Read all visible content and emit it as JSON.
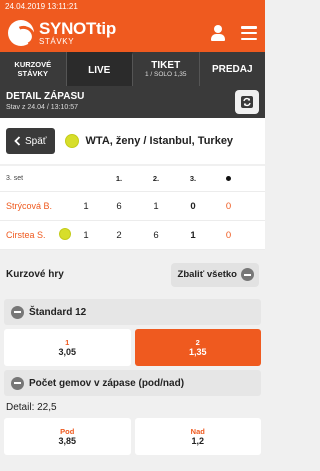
{
  "statusbar": {
    "datetime": "24.04.2019 13:11:21"
  },
  "brand": {
    "name": "SYNOTtip",
    "sub": "STÁVKY"
  },
  "nav": {
    "tabs": [
      {
        "l1": "KURZOVÉ",
        "l2": "STÁVKY"
      },
      {
        "l1": "LIVE"
      },
      {
        "l1": "TIKET",
        "l2": "1 / SOLO 1,35"
      },
      {
        "l1": "PREDAJ"
      }
    ]
  },
  "detail": {
    "title": "DETAIL ZÁPASU",
    "subtitle": "Stav z 24.04 / 13:10:57"
  },
  "match": {
    "back_label": "Späť",
    "event": "WTA, ženy / Istanbul, Turkey"
  },
  "score": {
    "set_label": "3. set",
    "headers": [
      "1.",
      "2.",
      "3."
    ],
    "players": [
      {
        "name": "Strýcová B.",
        "sets": "1",
        "s1": "6",
        "s2": "1",
        "s3": "0",
        "game": "0"
      },
      {
        "name": "Cirstea S.",
        "sets": "1",
        "s1": "2",
        "s2": "6",
        "s3": "1",
        "game": "0"
      }
    ]
  },
  "kurzove": {
    "title": "Kurzové hry",
    "expand_label": "Zbaliť všetko"
  },
  "markets": [
    {
      "title": "Štandard 12",
      "odds": [
        {
          "label": "1",
          "value": "3,05"
        },
        {
          "label": "2",
          "value": "1,35"
        }
      ]
    },
    {
      "title": "Počet gemov v zápase (pod/nad)",
      "detail": "Detail: 22,5",
      "odds": [
        {
          "label": "Pod",
          "value": "3,85"
        },
        {
          "label": "Nad",
          "value": "1,2"
        }
      ]
    }
  ],
  "colors": {
    "accent": "#ef5a1f",
    "dark": "#3a3a3a",
    "tennis_ball": "#d7de2a"
  },
  "icons": [
    "user-icon",
    "menu-icon",
    "refresh-icon",
    "chevron-left-icon",
    "tennis-ball-icon",
    "minus-circle-icon"
  ]
}
